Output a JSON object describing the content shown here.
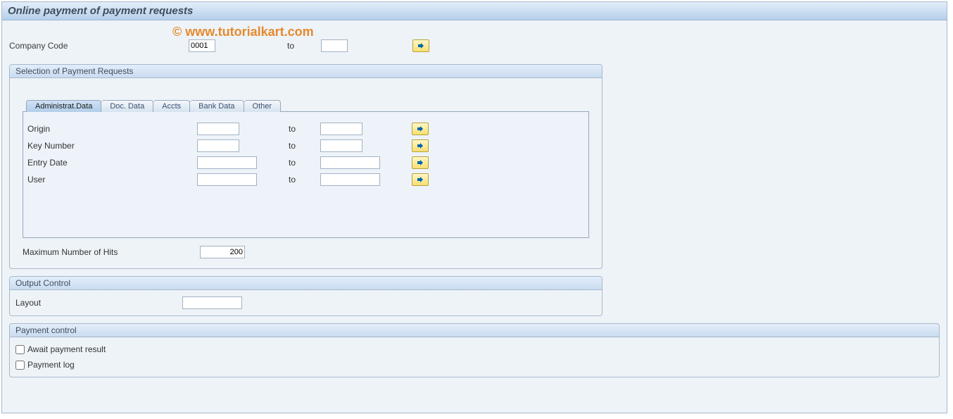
{
  "page_title": "Online payment of payment requests",
  "watermark": "© www.tutorialkart.com",
  "top": {
    "company_code_label": "Company Code",
    "company_code_value": "0001",
    "to_label": "to",
    "company_code_to": ""
  },
  "selection_group": {
    "legend": "Selection of Payment Requests",
    "tabs": [
      {
        "label": "Administrat.Data",
        "active": true
      },
      {
        "label": "Doc. Data",
        "active": false
      },
      {
        "label": "Accts",
        "active": false
      },
      {
        "label": "Bank Data",
        "active": false
      },
      {
        "label": "Other",
        "active": false
      }
    ],
    "rows": [
      {
        "label": "Origin",
        "from": "",
        "to_label": "to",
        "to": ""
      },
      {
        "label": "Key Number",
        "from": "",
        "to_label": "to",
        "to": ""
      },
      {
        "label": "Entry Date",
        "from": "",
        "to_label": "to",
        "to": ""
      },
      {
        "label": "User",
        "from": "",
        "to_label": "to",
        "to": ""
      }
    ],
    "max_hits_label": "Maximum Number of Hits",
    "max_hits_value": "200"
  },
  "output_control": {
    "legend": "Output Control",
    "layout_label": "Layout",
    "layout_value": ""
  },
  "payment_control": {
    "legend": "Payment control",
    "await_label": "Await payment result",
    "await_checked": false,
    "log_label": "Payment log",
    "log_checked": false
  }
}
